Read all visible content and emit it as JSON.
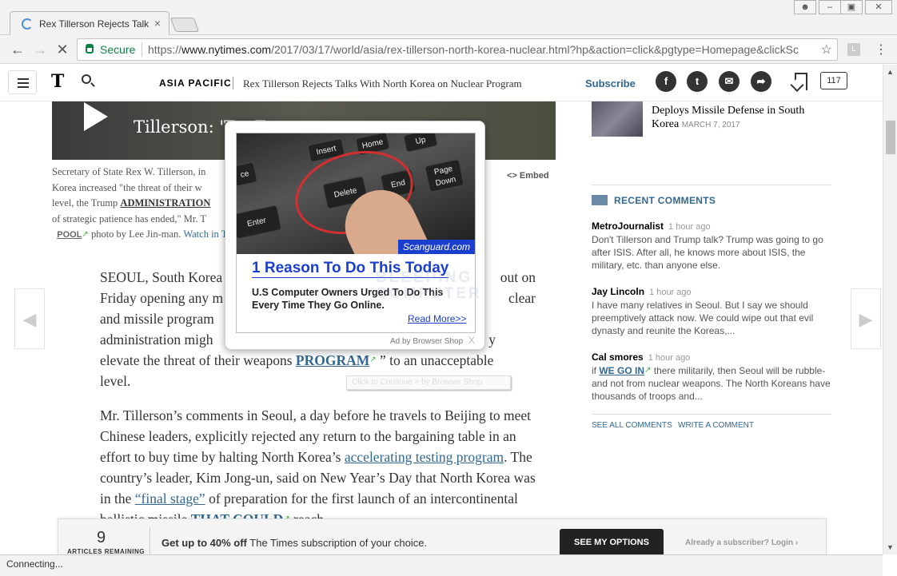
{
  "browser": {
    "tab_title": "Rex Tillerson Rejects Talk",
    "secure_label": "Secure",
    "url_prefix": "https://",
    "url_host": "www.nytimes.com",
    "url_path": "/2017/03/17/world/asia/rex-tillerson-north-korea-nuclear.html?hp&action=click&pgtype=Homepage&clickSc",
    "extension_label": "L",
    "status_text": "Connecting..."
  },
  "header": {
    "section": "ASIA PACIFIC",
    "title": "Rex Tillerson Rejects Talks With North Korea on Nuclear Program",
    "subscribe": "Subscribe",
    "comment_count": "117"
  },
  "video": {
    "title": "Tillerson: 'T                                    s En..."
  },
  "caption": {
    "line1": "Secretary of State Rex W. Tillerson, in",
    "line2": "Korea increased \"the threat of their w",
    "line3_pre": "level, the Trump",
    "line3_link": "ADMINISTRATION",
    "line4": "of strategic patience has ended,\" Mr. T",
    "pool": "POOL",
    "photo": "photo by Lee Jin-man.",
    "watch": "Watch in T",
    "embed": "Embed"
  },
  "article": {
    "p1_a": "SEOUL, South Korea",
    "p1_b": "Friday opening any m",
    "p1_c": "and missile program",
    "p1_d": "administration migh",
    "p1_e_pre": "elevate the threat of their weapons",
    "p1_e_link": "PROGRAM",
    "p1_e_post": "” to an unacceptable",
    "p1_f": "level.",
    "p1_right1": "out on",
    "p1_right2": "clear",
    "p1_right4": "y",
    "p2_a": "Mr. Tillerson’s comments in Seoul, a day before he travels to Beijing to meet Chinese leaders, explicitly rejected any return to the bargaining table in an effort to buy time by halting North Korea’s",
    "p2_link1": "accelerating testing program",
    "p2_b": ". The country’s leader, Kim Jong-un, said on New Year’s Day that North Korea was in the",
    "p2_link2": "“final stage”",
    "p2_c": "of preparation for the first launch of an intercontinental ballistic missile",
    "p2_link3": "THAT COULD",
    "p2_d": "reach"
  },
  "sidebar": {
    "related_title": "Deploys Missile Defense in South Korea",
    "related_date": "MARCH 7, 2017",
    "recent_heading": "RECENT COMMENTS",
    "comments": [
      {
        "author": "MetroJournalist",
        "time": "1 hour ago",
        "text": "Don't Tillerson and Trump talk? Trump was going to go after ISIS. After all, he knows more about ISIS, the military, etc. than anyone else."
      },
      {
        "author": "Jay Lincoln",
        "time": "1 hour ago",
        "text": "I have many relatives in Seoul. But I say we should preemptively attack now. We could wipe out that evil dynasty and reunite the Koreas,..."
      },
      {
        "author": "Cal smores",
        "time": "1 hour ago",
        "text_pre": "if",
        "link": "WE GO IN",
        "text": "there militarily, then Seoul will be rubble- and not from nuclear weapons. The North Koreans have thousands of troops and..."
      }
    ],
    "see_all": "SEE ALL COMMENTS",
    "write": "WRITE A COMMENT"
  },
  "ad": {
    "brand": "Scanguard.com",
    "headline": "1 Reason To Do This Today",
    "desc": "U.S Computer Owners Urged To Do This Every Time They Go Online.",
    "read_more": "Read More>>",
    "ad_by": "Ad by Browser Shop",
    "close": "X",
    "keys": [
      "Insert",
      "Home",
      "Up",
      "Delete",
      "End",
      "Page Down",
      "Enter",
      "ce"
    ],
    "watermark": "BLEEPING COMPUTER",
    "tooltip": "Click to Continue > by Browser Shop"
  },
  "banner": {
    "count": "9",
    "remaining": "ARTICLES REMAINING",
    "offer_bold": "Get up to 40% off",
    "offer_rest": " The Times subscription of your choice.",
    "button": "SEE MY OPTIONS",
    "login": "Already a subscriber? Login ›"
  }
}
